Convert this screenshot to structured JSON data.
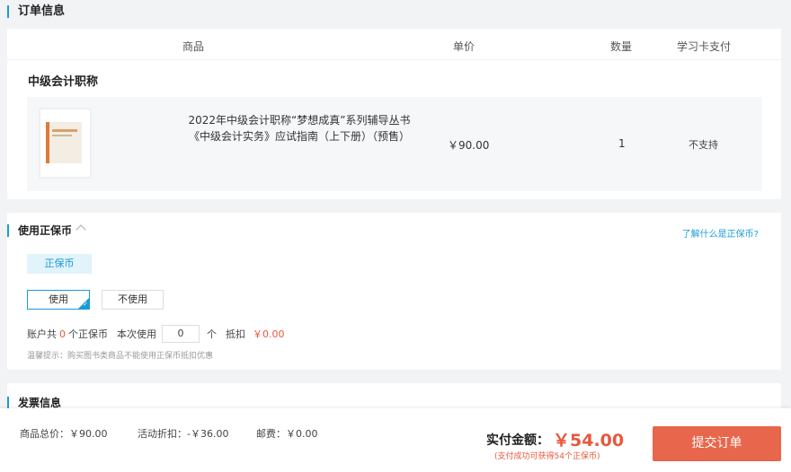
{
  "order_section": {
    "title": "订单信息",
    "headers": {
      "product": "商品",
      "unit_price": "单价",
      "quantity": "数量",
      "card_pay": "学习卡支付"
    },
    "course_name": "中级会计职称",
    "item": {
      "title_line1": "2022年中级会计职称“梦想成真”系列辅导丛书",
      "title_line2": "《中级会计实务》应试指南（上下册）（预售）",
      "price": "￥90.00",
      "quantity": "1",
      "card_pay": "不支持"
    }
  },
  "coin_section": {
    "title": "使用正保币",
    "help_link": "了解什么是正保币?",
    "tag": "正保币",
    "use_label": "使用",
    "no_use_label": "不使用",
    "account_prefix": "账户共",
    "account_count": "0",
    "account_suffix": "个正保币",
    "use_this_time": "本次使用",
    "use_value": "0",
    "unit": "个",
    "deduct_label": "抵扣",
    "deduct_amount": "￥0.00",
    "tip": "温馨提示：购买图书类商品不能使用正保币抵扣优惠"
  },
  "invoice_section": {
    "title": "发票信息"
  },
  "footer": {
    "total_label": "商品总价：￥90.00",
    "discount_label": "活动折扣：-￥36.00",
    "shipping_label": "邮费：￥0.00",
    "pay_label": "实付金额：",
    "pay_amount": "￥54.00",
    "pay_note": "(支付成功可获得54个正保币)",
    "submit": "提交订单"
  },
  "colors": {
    "accent": "#1a9bd7",
    "price_red": "#e8583d",
    "submit_bg": "#e8674c"
  }
}
